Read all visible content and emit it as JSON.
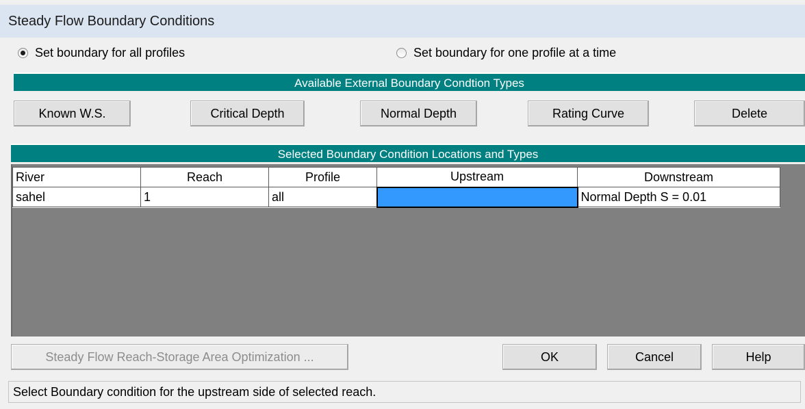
{
  "window": {
    "title": "Steady Flow Boundary Conditions"
  },
  "radios": {
    "all_profiles": {
      "label": "Set boundary for all profiles",
      "checked": true
    },
    "one_profile": {
      "label": "Set boundary for one profile at a time",
      "checked": false
    }
  },
  "sections": {
    "available_types": "Available External Boundary Condtion Types",
    "selected_locations": "Selected Boundary Condition Locations and Types"
  },
  "type_buttons": {
    "known_ws": "Known W.S.",
    "critical_depth": "Critical Depth",
    "normal_depth": "Normal Depth",
    "rating_curve": "Rating Curve",
    "delete": "Delete"
  },
  "table": {
    "headers": {
      "river": "River",
      "reach": "Reach",
      "profile": "Profile",
      "upstream": "Upstream",
      "downstream": "Downstream"
    },
    "rows": [
      {
        "river": "sahel",
        "reach": "1",
        "profile": "all",
        "upstream": "",
        "downstream": "Normal Depth S = 0.01"
      }
    ]
  },
  "footer_buttons": {
    "optimization": "Steady Flow Reach-Storage Area Optimization ...",
    "ok": "OK",
    "cancel": "Cancel",
    "help": "Help"
  },
  "status_text": "Select Boundary condition for the upstream side of selected reach.",
  "colors": {
    "accent_band": "#008080",
    "selected_cell": "#3399ff",
    "grid_background": "#808080"
  }
}
